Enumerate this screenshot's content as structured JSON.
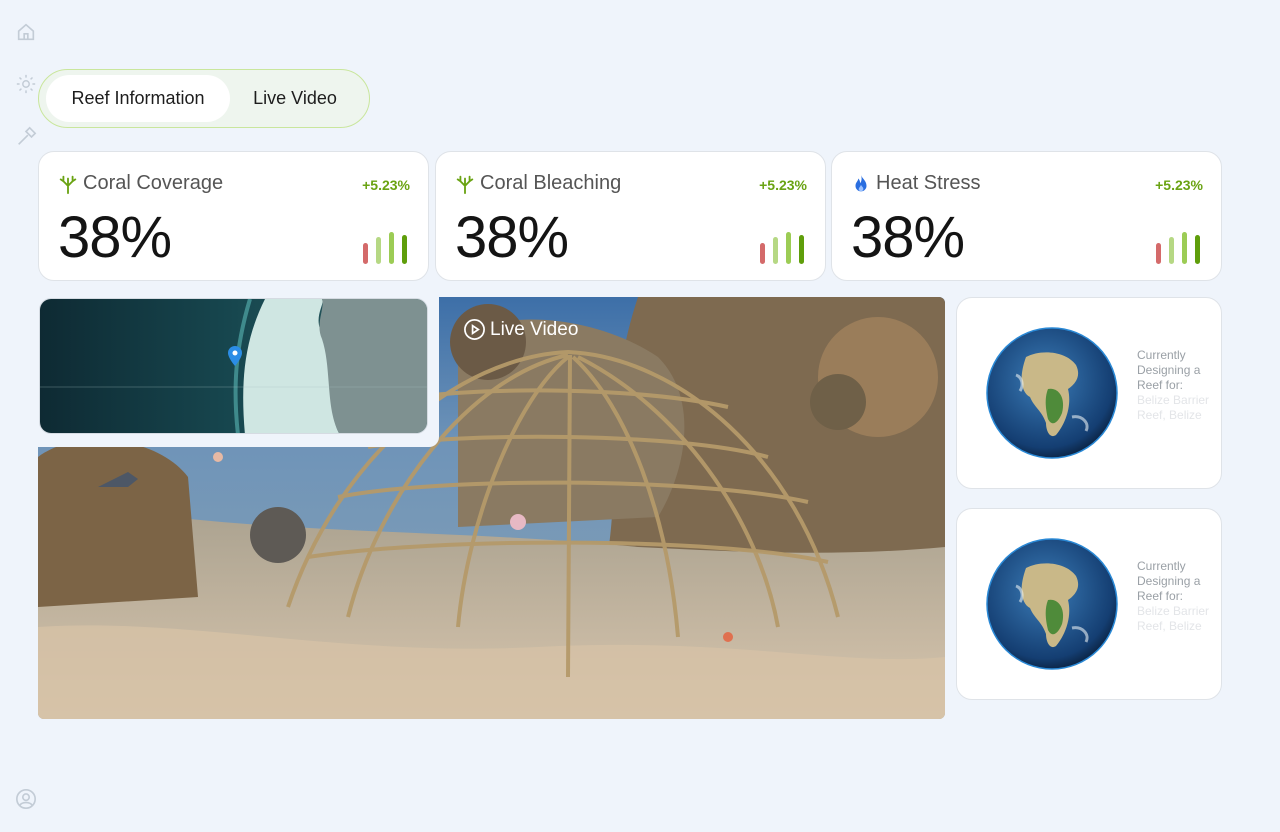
{
  "sidebar": {
    "icons": [
      "home-icon",
      "gear-icon",
      "hammer-icon",
      "user-icon"
    ]
  },
  "tabs": [
    {
      "label": "Reef Information",
      "active": true
    },
    {
      "label": "Live Video",
      "active": false
    }
  ],
  "stats": [
    {
      "icon": "coral-icon",
      "label": "Coral Coverage",
      "value": "38%",
      "delta": "+5.23%"
    },
    {
      "icon": "coral-icon",
      "label": "Coral Bleaching",
      "value": "38%",
      "delta": "+5.23%"
    },
    {
      "icon": "flame-icon",
      "label": "Heat Stress",
      "value": "38%",
      "delta": "+5.23%"
    }
  ],
  "video": {
    "label": "Live Video"
  },
  "globe_cards": [
    {
      "text": "Currently Designing a Reef for:",
      "location": "Belize Barrier Reef, Belize"
    },
    {
      "text": "Currently Designing a Reef for:",
      "location": "Belize Barrier Reef, Belize"
    }
  ],
  "colors": {
    "accent_green": "#6aa313",
    "bar_red": "#d46a6a",
    "bar_light_green": "#b6d884",
    "bar_mid_green": "#9ccc55",
    "bar_dark_green": "#5f9e0b",
    "flame_blue": "#2a6ee0",
    "background": "#eff4fb"
  }
}
